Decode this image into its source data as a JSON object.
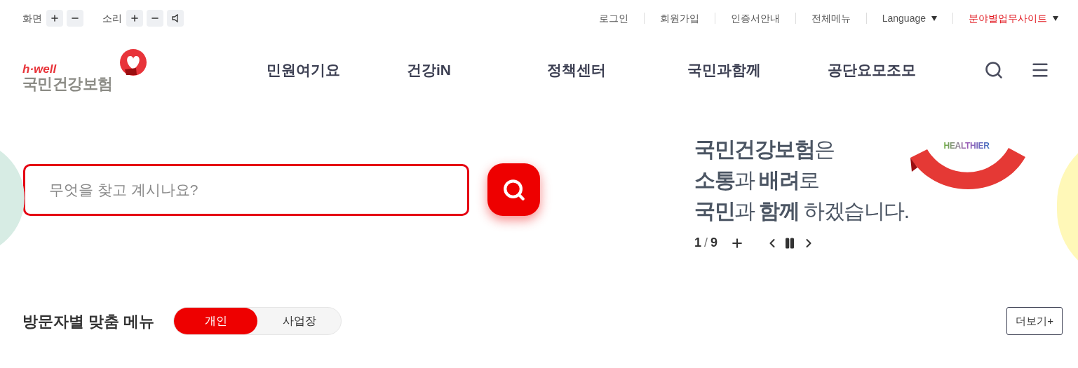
{
  "utility_bar": {
    "screen": {
      "label": "화면"
    },
    "sound": {
      "label": "소리"
    },
    "links": [
      {
        "label": "로그인",
        "kind": "plain"
      },
      {
        "label": "회원가입",
        "kind": "plain"
      },
      {
        "label": "인증서안내",
        "kind": "plain"
      },
      {
        "label": "전체메뉴",
        "kind": "plain"
      },
      {
        "label": "Language",
        "kind": "dropdown"
      },
      {
        "label": "분야별업무사이트",
        "kind": "dropdown-red"
      }
    ]
  },
  "logo": {
    "tagline": "h·well",
    "name": "국민건강보험"
  },
  "nav": [
    "민원여기요",
    "건강iN",
    "정책센터",
    "국민과함께",
    "공단요모조모"
  ],
  "search": {
    "placeholder": "무엇을 찾고 계시나요?"
  },
  "banner": {
    "lines": [
      "**국민건강보험**은",
      "**소통**과 **배려**로",
      "**국민**과 **함께** 하겠습니다."
    ],
    "ribbon_text": "HEALTHIER",
    "current": "1",
    "separator": "/",
    "total": "9",
    "paused": false
  },
  "visitor_menu": {
    "title": "방문자별 맞춤 메뉴",
    "tabs": [
      {
        "label": "개인",
        "selected": true
      },
      {
        "label": "사업장",
        "selected": false
      }
    ],
    "more": "더보기+"
  }
}
